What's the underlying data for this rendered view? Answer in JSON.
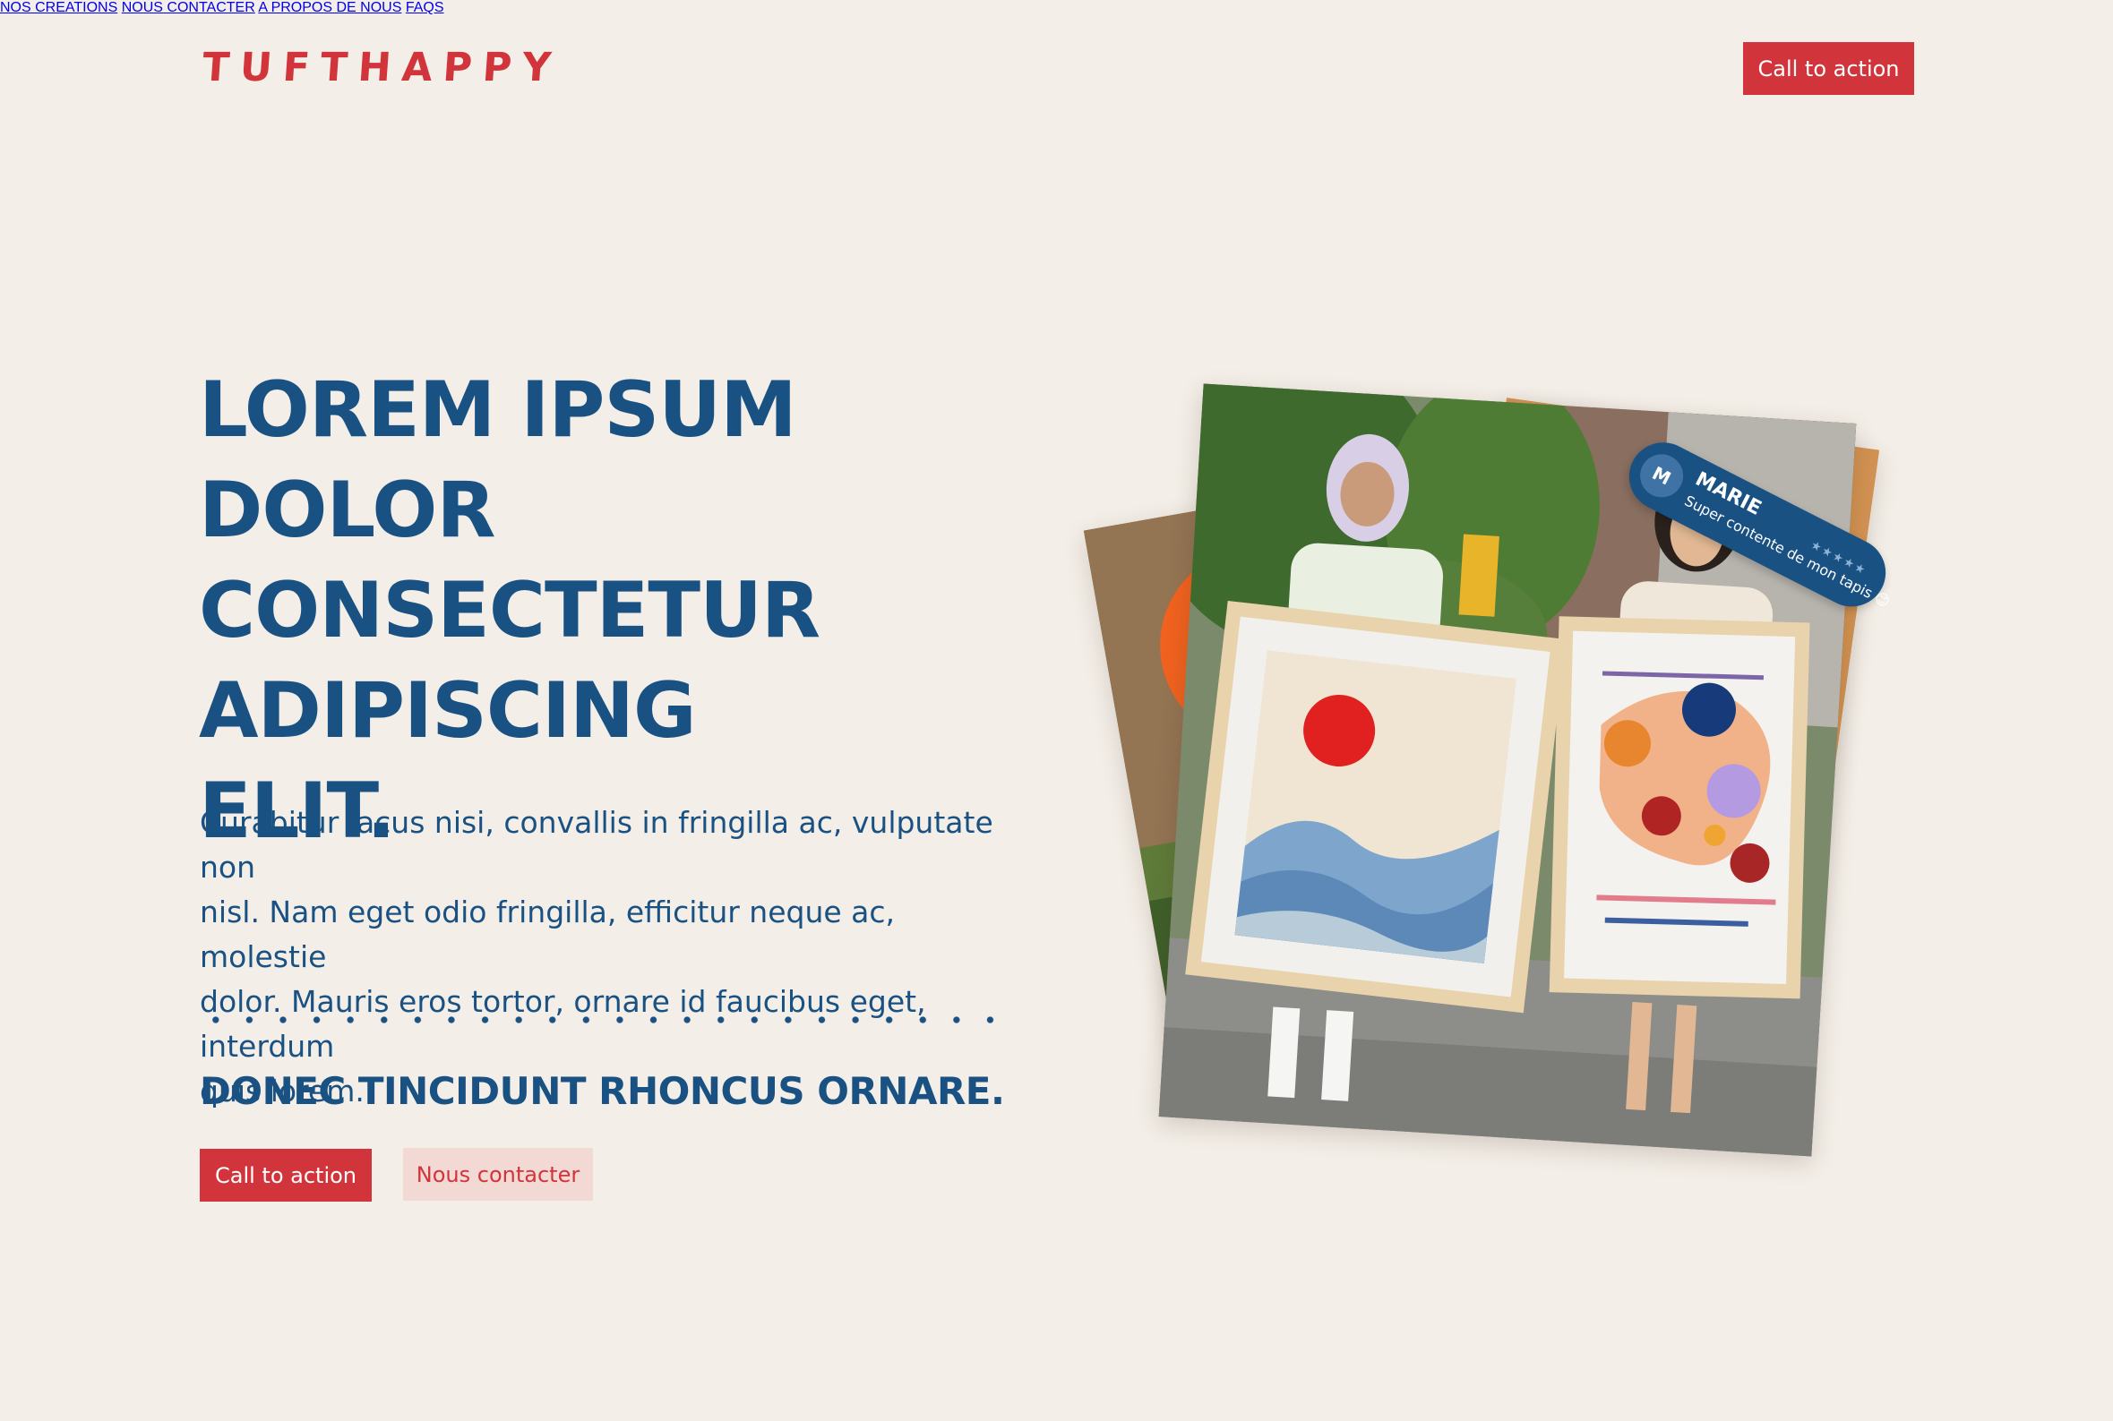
{
  "header": {
    "logo": "TUFTHAPPY",
    "nav": [
      "NOS CREATIONS",
      "NOUS CONTACTER",
      "A PROPOS DE NOUS",
      "FAQS"
    ],
    "cta": "Call to action"
  },
  "hero": {
    "title_lines": [
      "LOREM IPSUM",
      "DOLOR",
      "CONSECTETUR",
      "ADIPISCING ELIT."
    ],
    "paragraph_lines": [
      "Curabitur lacus nisi, convallis in fringilla ac, vulputate non",
      "nisl. Nam eget odio fringilla, efficitur neque ac, molestie",
      "dolor. Mauris eros tortor, ornare id faucibus eget, interdum",
      "quis lorem."
    ],
    "subheading": "DONEC TINCIDUNT RHONCUS ORNARE.",
    "primary_button": "Call to action",
    "secondary_button": "Nous contacter"
  },
  "review": {
    "avatar_letter": "M",
    "name": "MARIE",
    "quote": "Super contente de mon tapis 😊",
    "stars": "★★★★★"
  },
  "colors": {
    "background": "#f3eee7",
    "brand_red": "#d1343a",
    "brand_blue": "#1a5183",
    "soft_pink": "#f3d9d3"
  }
}
